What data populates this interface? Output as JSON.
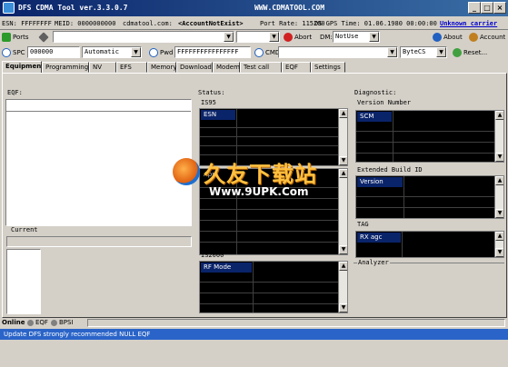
{
  "window": {
    "title": "DFS CDMA Tool ver.3.3.0.7",
    "url": "WWW.CDMATOOL.COM",
    "min": "_",
    "max": "□",
    "close": "×"
  },
  "infobar": {
    "esn": "ESN: FFFFFFFF",
    "meid": "MEID: 0000000000",
    "site": "cdmatool.com:",
    "account": "<AccountNotExist>",
    "port_rate": "Port Rate: 115200",
    "gps_time": "DS GPS Time: 01.06.1980 00:00:00",
    "carrier": "Unknown carrier"
  },
  "toolbar1": {
    "ports": "Ports",
    "abort": "Abort",
    "dm_label": "DM:",
    "dm_value": "NotUse",
    "about": "About",
    "account": "Account"
  },
  "toolbar2": {
    "spc_label": "SPC",
    "spc_value": "000000",
    "spc_mode": "Automatic",
    "pwd_label": "Pwd",
    "pwd_value": "FFFFFFFFFFFFFFFF",
    "cmd_label": "CMD",
    "cmd_mode": "ByteCS",
    "reset": "Reset..."
  },
  "tabs": [
    "Equipment",
    "Programming",
    "NV",
    "EFS",
    "Memory",
    "Download",
    "Modem",
    "Test call",
    "EQF",
    "Settings"
  ],
  "eqf": {
    "label": "EQF:",
    "current_label": "Current"
  },
  "status": {
    "label": "Status:",
    "is95_label": "IS95",
    "is95_header": "ESN",
    "s2_header": "Appl",
    "is2000_label": "IS2000",
    "is2000_header": "RF Mode"
  },
  "diagnostic": {
    "label": "Diagnostic:",
    "version_label": "Version Number",
    "version_header": "SCM",
    "build_label": "Extended Build ID",
    "build_header": "Version",
    "tag_label": "TAG",
    "tag_header": "RX agc",
    "analyzer_label": "Analyzer"
  },
  "bottom_tabs": [
    "Online",
    "EQF",
    "BPSI"
  ],
  "statusbar": {
    "text": "Update DFS strongly recommended  NULL EQF"
  },
  "watermark": {
    "cn": "久友下载站",
    "en": "Www.9UPK.Com"
  }
}
